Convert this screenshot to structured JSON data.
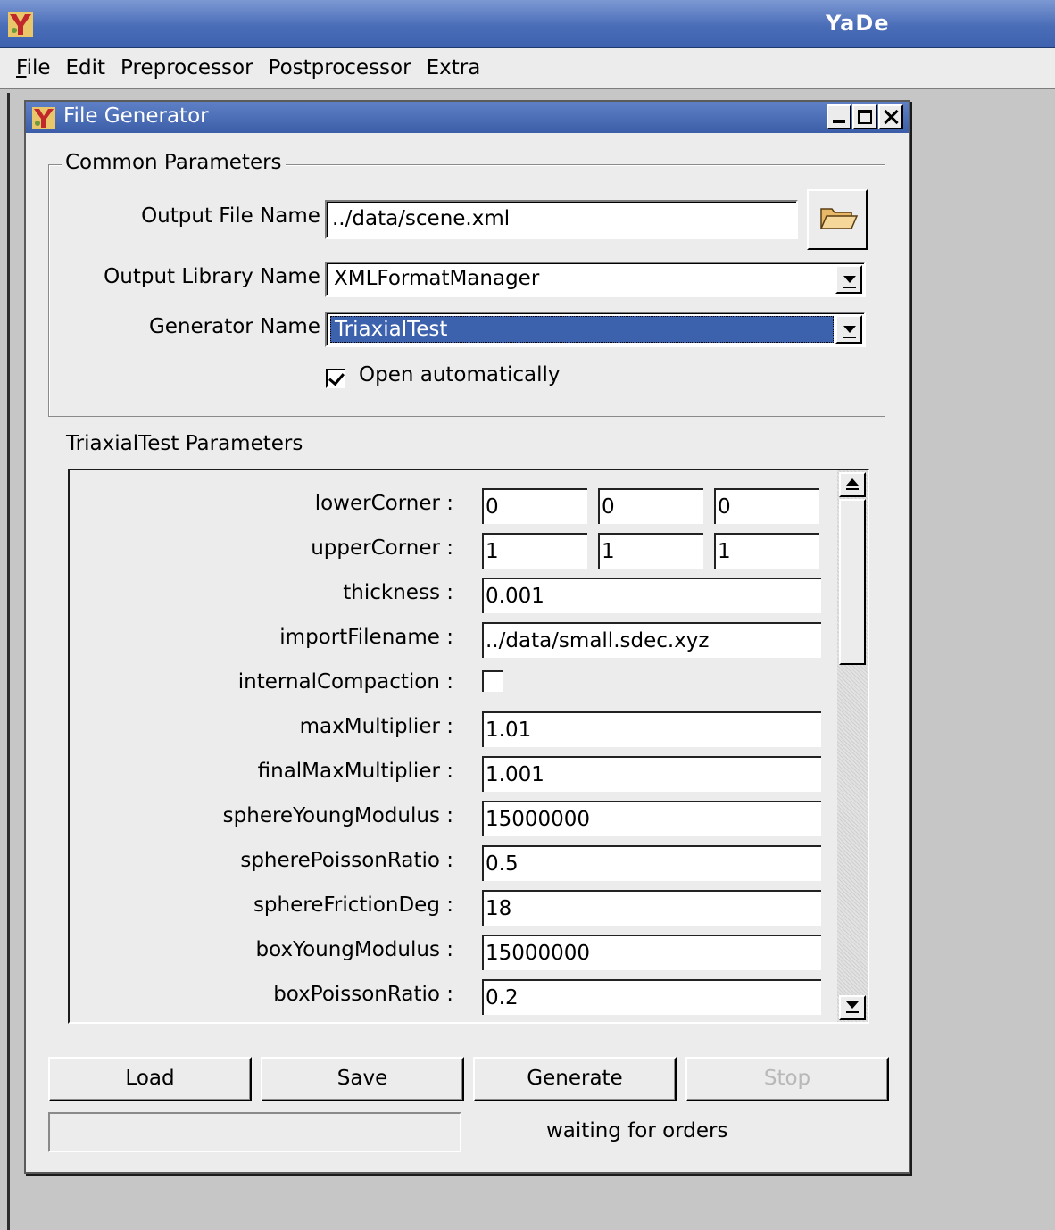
{
  "app": {
    "title": "YaDe",
    "icon": "yade-logo-icon"
  },
  "menubar": {
    "items": [
      {
        "label": "ile",
        "mnemonic": "F"
      },
      {
        "label": "Edit"
      },
      {
        "label": "Preprocessor"
      },
      {
        "label": "Postprocessor"
      },
      {
        "label": "Extra"
      }
    ]
  },
  "window": {
    "title": "File Generator",
    "icon": "yade-logo-icon",
    "buttons": [
      "minimize-icon",
      "maximize-icon",
      "close-icon"
    ]
  },
  "common": {
    "legend": "Common Parameters",
    "output_file_label": "Output File Name :",
    "output_file_value": "../data/scene.xml",
    "browse_icon": "folder-icon",
    "output_library_label": "Output Library Name :",
    "output_library_value": "XMLFormatManager",
    "generator_label": "Generator Name :",
    "generator_value": "TriaxialTest",
    "open_auto_label": "Open automatically",
    "open_auto_checked": true
  },
  "params": {
    "title": "TriaxialTest Parameters",
    "lowerCorner": {
      "label": "lowerCorner :",
      "values": [
        "0",
        "0",
        "0"
      ]
    },
    "upperCorner": {
      "label": "upperCorner :",
      "values": [
        "1",
        "1",
        "1"
      ]
    },
    "thickness": {
      "label": "thickness :",
      "value": "0.001"
    },
    "importFilename": {
      "label": "importFilename :",
      "value": "../data/small.sdec.xyz"
    },
    "internalCompaction": {
      "label": "internalCompaction :",
      "checked": false
    },
    "maxMultiplier": {
      "label": "maxMultiplier :",
      "value": "1.01"
    },
    "finalMaxMultiplier": {
      "label": "finalMaxMultiplier :",
      "value": "1.001"
    },
    "sphereYoungModulus": {
      "label": "sphereYoungModulus :",
      "value": "15000000"
    },
    "spherePoissonRatio": {
      "label": "spherePoissonRatio :",
      "value": "0.5"
    },
    "sphereFrictionDeg": {
      "label": "sphereFrictionDeg :",
      "value": "18"
    },
    "boxYoungModulus": {
      "label": "boxYoungModulus :",
      "value": "15000000"
    },
    "boxPoissonRatio": {
      "label": "boxPoissonRatio :",
      "value": "0.2"
    }
  },
  "actions": {
    "load": "Load",
    "save": "Save",
    "generate": "Generate",
    "stop": "Stop",
    "stop_enabled": false
  },
  "status": {
    "text": "waiting for orders",
    "progress": 0
  }
}
